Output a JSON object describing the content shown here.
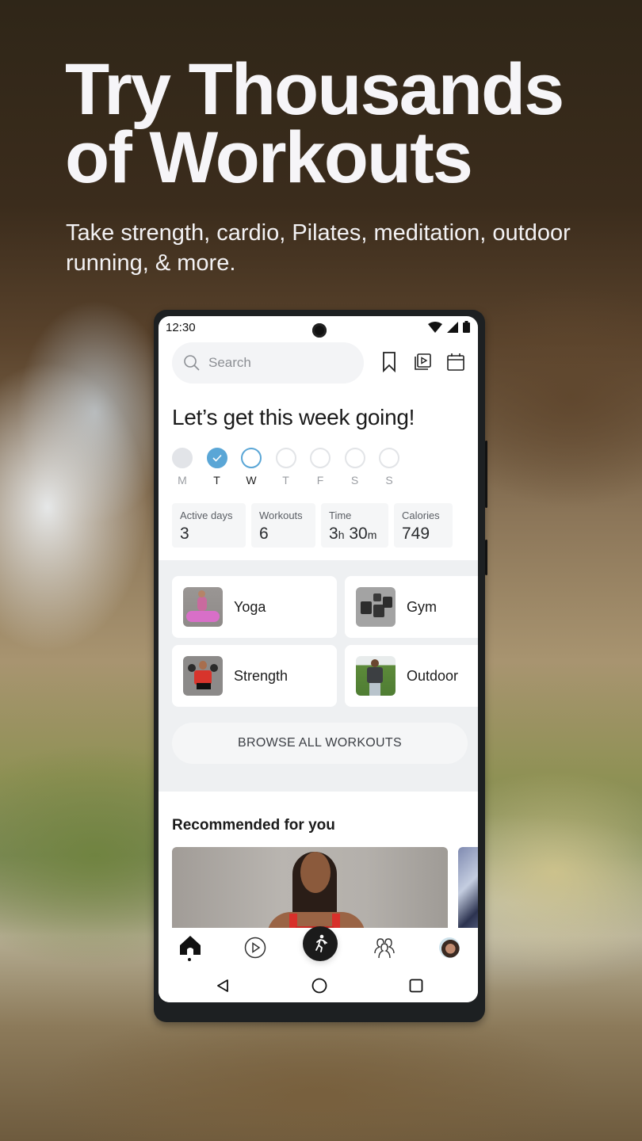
{
  "promo": {
    "headline_line1": "Try Thousands",
    "headline_line2": "of Workouts",
    "subhead": "Take strength, cardio, Pilates, meditation, outdoor running, & more."
  },
  "status_bar": {
    "time": "12:30",
    "icons": [
      "wifi-icon",
      "signal-icon",
      "battery-icon"
    ]
  },
  "header": {
    "search_placeholder": "Search",
    "icons": [
      "bookmark-icon",
      "playlist-icon",
      "calendar-icon"
    ]
  },
  "week": {
    "greeting": "Let’s get this week going!",
    "days": [
      {
        "label": "M",
        "state": "past"
      },
      {
        "label": "T",
        "state": "done"
      },
      {
        "label": "W",
        "state": "today"
      },
      {
        "label": "T",
        "state": "upcoming"
      },
      {
        "label": "F",
        "state": "upcoming"
      },
      {
        "label": "S",
        "state": "upcoming"
      },
      {
        "label": "S",
        "state": "upcoming"
      }
    ],
    "accent_color": "#5aa6d6"
  },
  "stats": [
    {
      "label": "Active days",
      "value": "3"
    },
    {
      "label": "Workouts",
      "value": "6"
    },
    {
      "label": "Time",
      "hours": "3",
      "h_unit": "h",
      "minutes": "30",
      "m_unit": "m"
    },
    {
      "label": "Calories",
      "value": "749"
    }
  ],
  "categories": [
    {
      "label": "Yoga",
      "thumb": "yoga-thumbnail"
    },
    {
      "label": "Gym",
      "thumb": "gym-thumbnail"
    },
    {
      "label": "Strength",
      "thumb": "strength-thumbnail"
    },
    {
      "label": "Outdoor",
      "thumb": "outdoor-thumbnail"
    }
  ],
  "browse_button": "BROWSE ALL WORKOUTS",
  "recommended": {
    "title": "Recommended for you"
  },
  "bottom_nav": [
    "home-icon",
    "play-icon",
    "run-icon",
    "community-icon",
    "profile-avatar"
  ],
  "system_nav": [
    "back-icon",
    "home-circle-icon",
    "recents-icon"
  ]
}
